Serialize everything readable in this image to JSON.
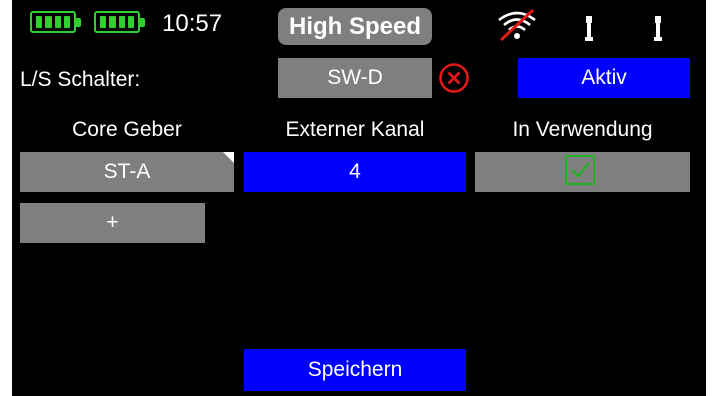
{
  "status_bar": {
    "time": "10:57",
    "mode": "High Speed",
    "icons": [
      "battery-icon",
      "battery-icon",
      "wifi-off-icon",
      "trim-icon",
      "trim-icon"
    ]
  },
  "switch_row": {
    "label": "L/S Schalter:",
    "switch_value": "SW-D",
    "state_button": "Aktiv"
  },
  "mapping_table": {
    "headers": [
      "Core Geber",
      "Externer Kanal",
      "In Verwendung"
    ],
    "rows": [
      {
        "core_geber": "ST-A",
        "externer_kanal": "4",
        "in_verwendung": true
      }
    ],
    "add_label": "+"
  },
  "save_button": "Speichern",
  "colors": {
    "background": "#000000",
    "button_grey": "#7f7f7f",
    "button_blue": "#0000ff",
    "battery_green": "#2fd12f",
    "delete_red": "#e01818",
    "check_green": "#24b024"
  }
}
